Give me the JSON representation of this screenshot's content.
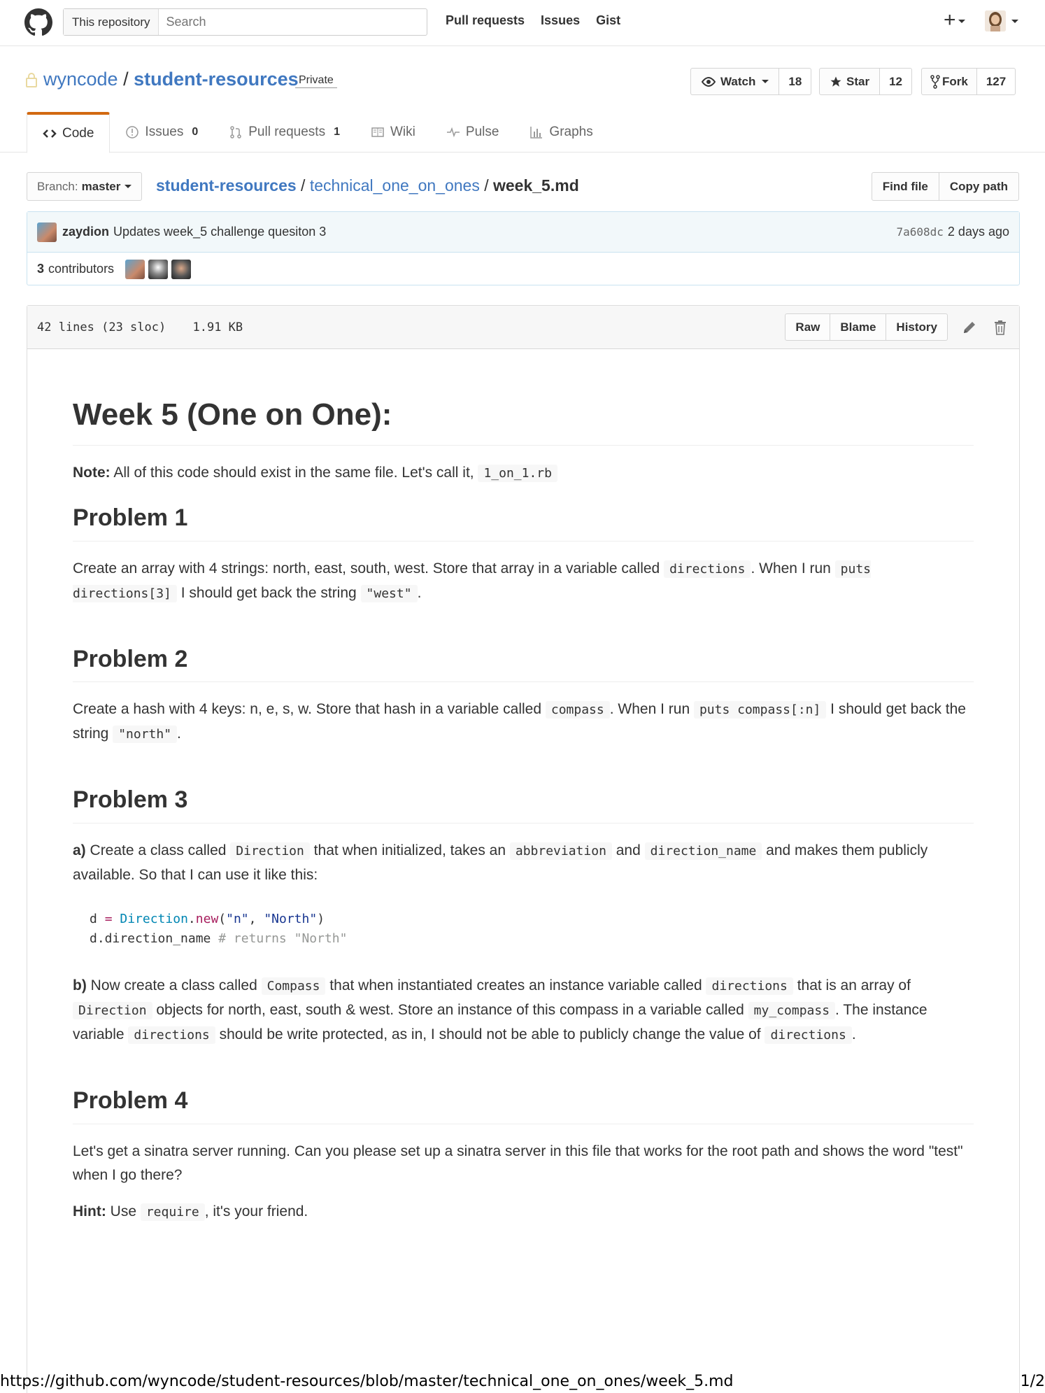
{
  "header": {
    "search_scope": "This repository",
    "search_placeholder": "Search",
    "nav": [
      "Pull requests",
      "Issues",
      "Gist"
    ],
    "plus": "+"
  },
  "repo": {
    "owner": "wyncode",
    "separator": "/",
    "name": "student-resources",
    "visibility": "Private",
    "watch_label": "Watch",
    "watch_count": "18",
    "star_label": "Star",
    "star_count": "12",
    "fork_label": "Fork",
    "fork_count": "127"
  },
  "tabs": [
    {
      "label": "Code",
      "count": ""
    },
    {
      "label": "Issues",
      "count": "0"
    },
    {
      "label": "Pull requests",
      "count": "1"
    },
    {
      "label": "Wiki",
      "count": ""
    },
    {
      "label": "Pulse",
      "count": ""
    },
    {
      "label": "Graphs",
      "count": ""
    }
  ],
  "file_nav": {
    "branch_label": "Branch:",
    "branch": "master",
    "crumb_root": "student-resources",
    "crumb_dir": "technical_one_on_ones",
    "crumb_file": "week_5.md",
    "sep": " / ",
    "find_file": "Find file",
    "copy_path": "Copy path"
  },
  "commit": {
    "author": "zaydion",
    "message": "Updates week_5 challenge quesiton 3",
    "sha": "7a608dc",
    "time": "2 days ago",
    "contributors_count": "3",
    "contributors_label": "contributors"
  },
  "file": {
    "lines": "42 lines (23 sloc)",
    "size": "1.91 KB",
    "raw": "Raw",
    "blame": "Blame",
    "history": "History"
  },
  "content": {
    "h1": "Week 5 (One on One):",
    "note_label": "Note:",
    "note_text": " All of this code should exist in the same file. Let's call it, ",
    "note_code": "1_on_1.rb",
    "p1_title": "Problem 1",
    "p1_a": "Create an array with 4 strings: north, east, south, west. Store that array in a variable called ",
    "p1_code1": "directions",
    "p1_b": ". When I run ",
    "p1_code2": "puts directions[3]",
    "p1_c": " I should get back the string ",
    "p1_code3": "\"west\"",
    "p1_d": ".",
    "p2_title": "Problem 2",
    "p2_a": "Create a hash with 4 keys: n, e, s, w. Store that hash in a variable called ",
    "p2_code1": "compass",
    "p2_b": ". When I run ",
    "p2_code2": "puts compass[:n]",
    "p2_c": " I should get back the string ",
    "p2_code3": "\"north\"",
    "p2_d": ".",
    "p3_title": "Problem 3",
    "p3a_label": "a)",
    "p3a_1": " Create a class called ",
    "p3a_code1": "Direction",
    "p3a_2": " that when initialized, takes an ",
    "p3a_code2": "abbreviation",
    "p3a_3": " and ",
    "p3a_code3": "direction_name",
    "p3a_4": " and makes them publicly available. So that I can use it like this:",
    "code_line1_a": "d ",
    "code_line1_eq": "=",
    "code_line1_cls": "Direction",
    "code_line1_dot": ".",
    "code_line1_new": "new",
    "code_line1_p1": "(",
    "code_line1_s1": "\"n\"",
    "code_line1_comma": ", ",
    "code_line1_s2": "\"North\"",
    "code_line1_p2": ")",
    "code_line2_a": "d.direction_name ",
    "code_line2_cm": "# returns \"North\"",
    "p3b_label": "b)",
    "p3b_1": " Now create a class called ",
    "p3b_code1": "Compass",
    "p3b_2": " that when instantiated creates an instance variable called ",
    "p3b_code2": "directions",
    "p3b_3": " that is an array of ",
    "p3b_code3": "Direction",
    "p3b_4": " objects for north, east, south & west. Store an instance of this compass in a variable called ",
    "p3b_code4": "my_compass",
    "p3b_5": ". The instance variable ",
    "p3b_code5": "directions",
    "p3b_6": " should be write protected, as in, I should not be able to publicly change the value of ",
    "p3b_code6": "directions",
    "p3b_7": ".",
    "p4_title": "Problem 4",
    "p4_text": "Let's get a sinatra server running. Can you please set up a sinatra server in this file that works for the root path and shows the word \"test\" when I go there?",
    "hint_label": "Hint:",
    "hint_1": " Use ",
    "hint_code": "require",
    "hint_2": ", it's your friend."
  },
  "footer": {
    "url": "https://github.com/wyncode/student-resources/blob/master/technical_one_on_ones/week_5.md",
    "page": "1/2"
  },
  "colors": {
    "link": "#4078c0",
    "tab_accent": "#d26911",
    "commit_bg": "#f2f8fa"
  }
}
